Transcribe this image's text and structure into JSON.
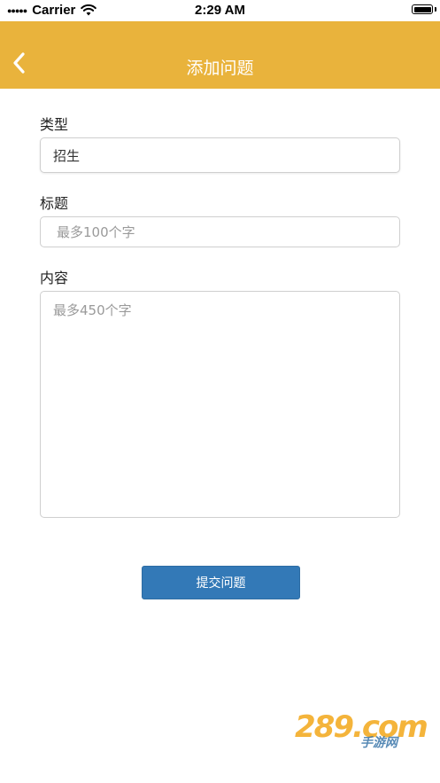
{
  "status_bar": {
    "carrier": "Carrier",
    "time": "2:29 AM"
  },
  "nav": {
    "title": "添加问题",
    "back_icon": "chevron-left-icon",
    "color": "#e9b33c"
  },
  "form": {
    "type": {
      "label": "类型",
      "value": "招生"
    },
    "title": {
      "label": "标题",
      "placeholder": "最多100个字"
    },
    "content": {
      "label": "内容",
      "placeholder": "最多450个字"
    },
    "submit_label": "提交问题",
    "submit_color": "#3379b7"
  },
  "watermark": {
    "logo_text": "289.com",
    "sub_text": "手游网"
  }
}
